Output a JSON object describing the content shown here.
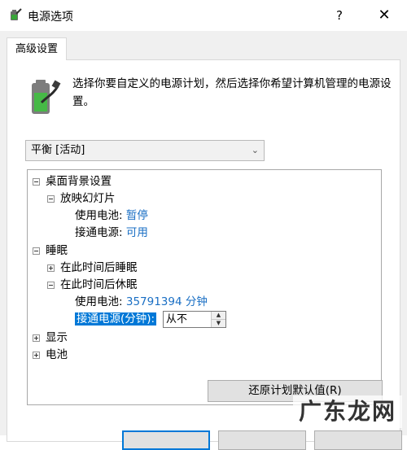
{
  "window": {
    "title": "电源选项",
    "help_label": "?",
    "close_label": "✕"
  },
  "tab": {
    "label": "高级设置"
  },
  "description": "选择你要自定义的电源计划，然后选择你希望计算机管理的电源设置。",
  "plan_select": {
    "value": "平衡 [活动]"
  },
  "tree": {
    "desktop_background": {
      "label": "桌面背景设置",
      "slideshow": {
        "label": "放映幻灯片",
        "battery_label": "使用电池:",
        "battery_value": "暂停",
        "plugged_label": "接通电源:",
        "plugged_value": "可用"
      }
    },
    "sleep": {
      "label": "睡眠",
      "sleep_after": {
        "label": "在此时间后睡眠"
      },
      "hibernate_after": {
        "label": "在此时间后休眠",
        "battery_label": "使用电池:",
        "battery_value": "35791394 分钟",
        "plugged_label": "接通电源(分钟):",
        "plugged_value": "从不"
      }
    },
    "display": {
      "label": "显示"
    },
    "battery": {
      "label": "电池"
    }
  },
  "restore_button": {
    "label": "还原计划默认值(R)"
  },
  "watermark": "广东龙网",
  "colors": {
    "accent": "#0078d7",
    "value_blue": "#1a6fc4",
    "panel_bg": "#f0f0f0"
  },
  "icons": {
    "app": "battery-plug-icon",
    "plan": "battery-plug-icon"
  }
}
